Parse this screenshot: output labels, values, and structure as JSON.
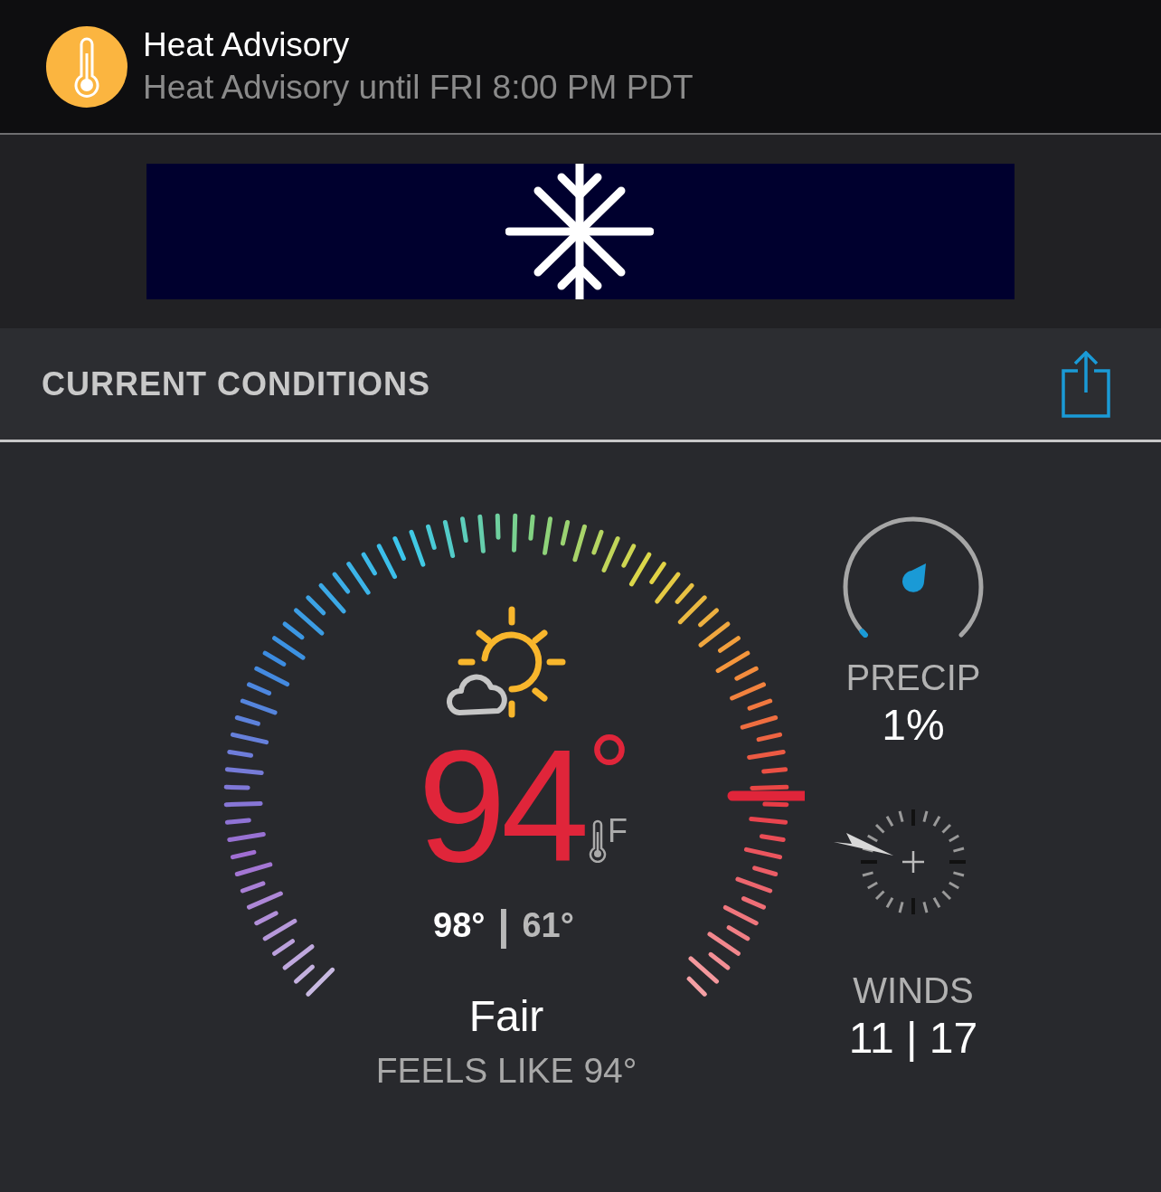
{
  "alert": {
    "title": "Heat Advisory",
    "message": "Heat Advisory until FRI 8:00 PM PDT"
  },
  "section": {
    "title": "CURRENT CONDITIONS"
  },
  "temperature": {
    "value": "94",
    "degree": "°",
    "unit": "F",
    "high": "98°",
    "separator": "|",
    "low": "61°",
    "condition": "Fair",
    "feels_like": "FEELS LIKE 94°"
  },
  "precip": {
    "label": "PRECIP",
    "value": "1%"
  },
  "winds": {
    "label": "WINDS",
    "value": "11 | 17"
  }
}
